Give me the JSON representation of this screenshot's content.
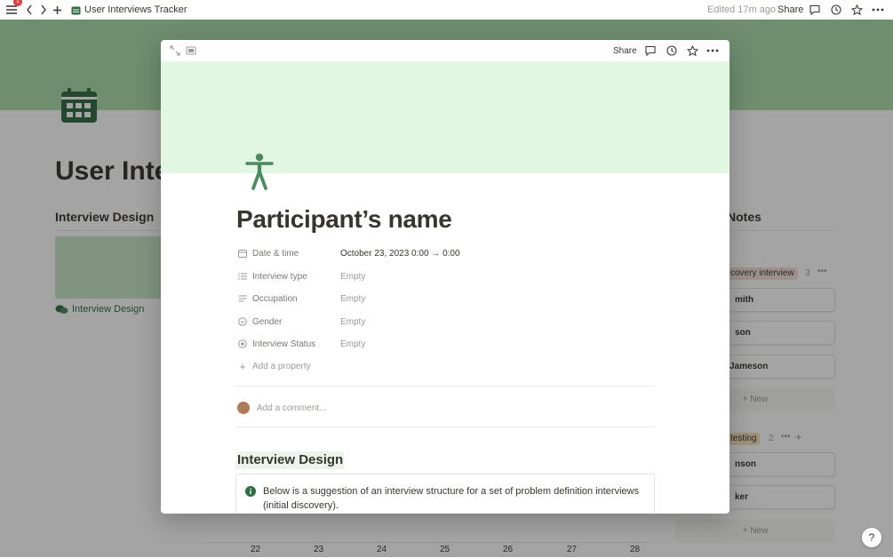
{
  "topbar": {
    "notification_count": "1",
    "page_title": "User Interviews Tracker",
    "edited": "Edited 17m ago",
    "share_label": "Share"
  },
  "background": {
    "heading": "User Inter",
    "interview_design_heading": "Interview Design",
    "interview_design_link": "Interview Design",
    "notes_heading": "Notes",
    "groups": [
      {
        "label": "covery interview",
        "count": "3",
        "color": "#f4dfd8"
      },
      {
        "label": "testing",
        "count": "2",
        "color": "#f7e2b5"
      }
    ],
    "cards_group1": [
      "mith",
      "son",
      "Jameson"
    ],
    "cards_group2": [
      "nson",
      "ker"
    ],
    "new_label": "+ New",
    "calendar_days": [
      "22",
      "23",
      "24",
      "25",
      "26",
      "27",
      "28"
    ]
  },
  "modal": {
    "share_label": "Share",
    "title": "Participant’s name",
    "properties": [
      {
        "name": "Date & time",
        "value": "October 23, 2023 0:00 → 0:00",
        "icon": "calendar-icon",
        "filled": true
      },
      {
        "name": "Interview type",
        "value": "Empty",
        "icon": "list-icon",
        "filled": false
      },
      {
        "name": "Occupation",
        "value": "Empty",
        "icon": "text-icon",
        "filled": false
      },
      {
        "name": "Gender",
        "value": "Empty",
        "icon": "select-icon",
        "filled": false
      },
      {
        "name": "Interview Status",
        "value": "Empty",
        "icon": "status-icon",
        "filled": false
      }
    ],
    "add_property": "Add a property",
    "comment_placeholder": "Add a comment...",
    "section_heading": "Interview Design",
    "callout_text": "Below is a suggestion of an interview structure for a set of problem definition interviews (initial discovery)."
  },
  "colors": {
    "cover": "#a8dba8",
    "modal_cover": "#e1f7e1",
    "icon_green": "#4a8a5c",
    "section_highlight": "#edf3ec"
  },
  "help_label": "?"
}
